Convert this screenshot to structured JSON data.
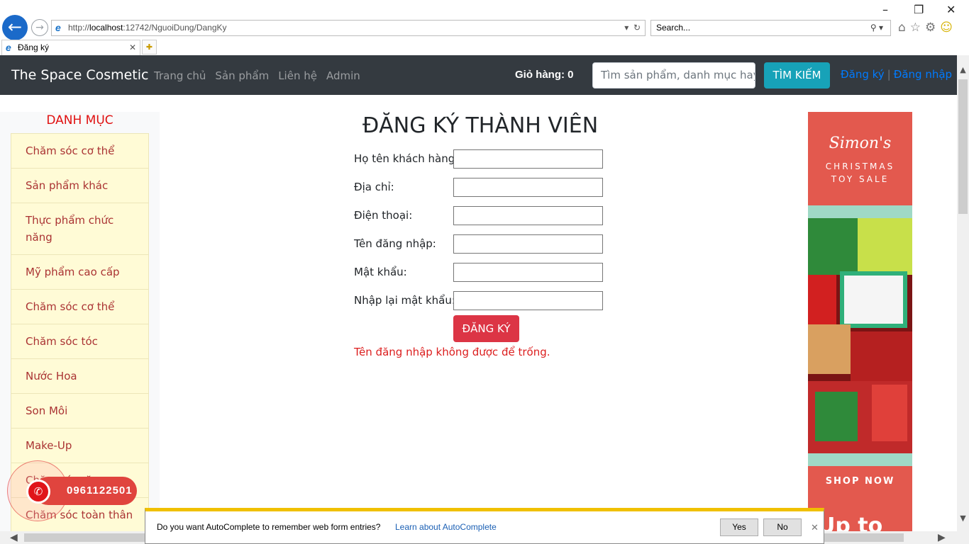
{
  "browser": {
    "url_prefix": "http://",
    "url_host": "localhost",
    "url_rest": ":12742/NguoiDung/DangKy",
    "search_placeholder": "Search...",
    "tab_title": "Đăng ký"
  },
  "navbar": {
    "brand": "The Space Cosmetic",
    "links": [
      "Trang chủ",
      "Sản phẩm",
      "Liên hệ",
      "Admin"
    ],
    "cart": "Giỏ hàng: 0",
    "search_placeholder": "Tìm sản phẩm, danh mục hay",
    "search_button": "TÌM KIẾM",
    "register": "Đăng ký",
    "login": "Đăng nhập"
  },
  "sidebar": {
    "title": "DANH MỤC",
    "items": [
      "Chăm sóc cơ thể",
      "Sản phẩm khác",
      "Thực phẩm chức năng",
      "Mỹ phẩm cao cấp",
      "Chăm sóc cơ thể",
      "Chăm sóc tóc",
      "Nước Hoa",
      "Son Môi",
      "Make-Up",
      "Chăm sóc răng",
      "Chăm sóc toàn thân"
    ]
  },
  "form": {
    "title": "ĐĂNG KÝ THÀNH VIÊN",
    "fields": [
      {
        "label": "Họ tên khách hàng:",
        "value": ""
      },
      {
        "label": "Địa chỉ:",
        "value": ""
      },
      {
        "label": "Điện thoại:",
        "value": ""
      },
      {
        "label": "Tên đăng nhập:",
        "value": ""
      },
      {
        "label": "Mật khẩu:",
        "value": ""
      },
      {
        "label": "Nhập lại mật khẩu:",
        "value": ""
      }
    ],
    "submit": "ĐĂNG KÝ",
    "error": "Tên đăng nhập không được để trống."
  },
  "banner": {
    "brand": "Simon's",
    "line1": "CHRISTMAS",
    "line2": "TOY SALE",
    "shop_now": "SHOP NOW",
    "up_to": "Up to"
  },
  "phone_widget": {
    "number": "0961122501"
  },
  "autocomplete_bar": {
    "message": "Do you want AutoComplete to remember web form entries?",
    "learn_link": "Learn about AutoComplete",
    "yes": "Yes",
    "no": "No"
  }
}
